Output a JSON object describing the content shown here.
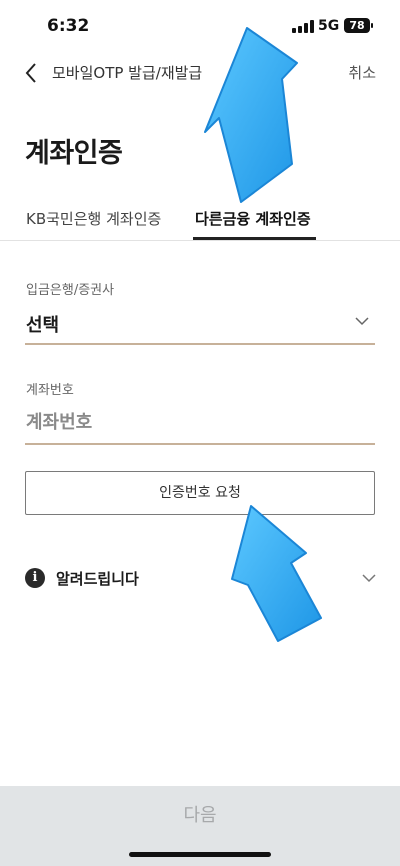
{
  "status_bar": {
    "time": "6:32",
    "network": "5G",
    "battery": "78"
  },
  "header": {
    "title": "모바일OTP 발급/재발급",
    "cancel_label": "취소",
    "back_icon": "chevron-left-icon"
  },
  "page_title": "계좌인증",
  "tabs": [
    {
      "label": "KB국민은행 계좌인증",
      "selected": false
    },
    {
      "label": "다른금융 계좌인증",
      "selected": true
    }
  ],
  "bank_field": {
    "label": "입금은행/증권사",
    "value": "선택"
  },
  "account_field": {
    "label": "계좌번호",
    "placeholder": "계좌번호"
  },
  "request_button_label": "인증번호 요청",
  "notice": {
    "icon": "info-icon",
    "label": "알려드립니다"
  },
  "next_button_label": "다음",
  "colors": {
    "field_underline": "#c7b199",
    "annotation_arrow": "#29a8f0",
    "bottom_bar": "#e1e4e6"
  }
}
